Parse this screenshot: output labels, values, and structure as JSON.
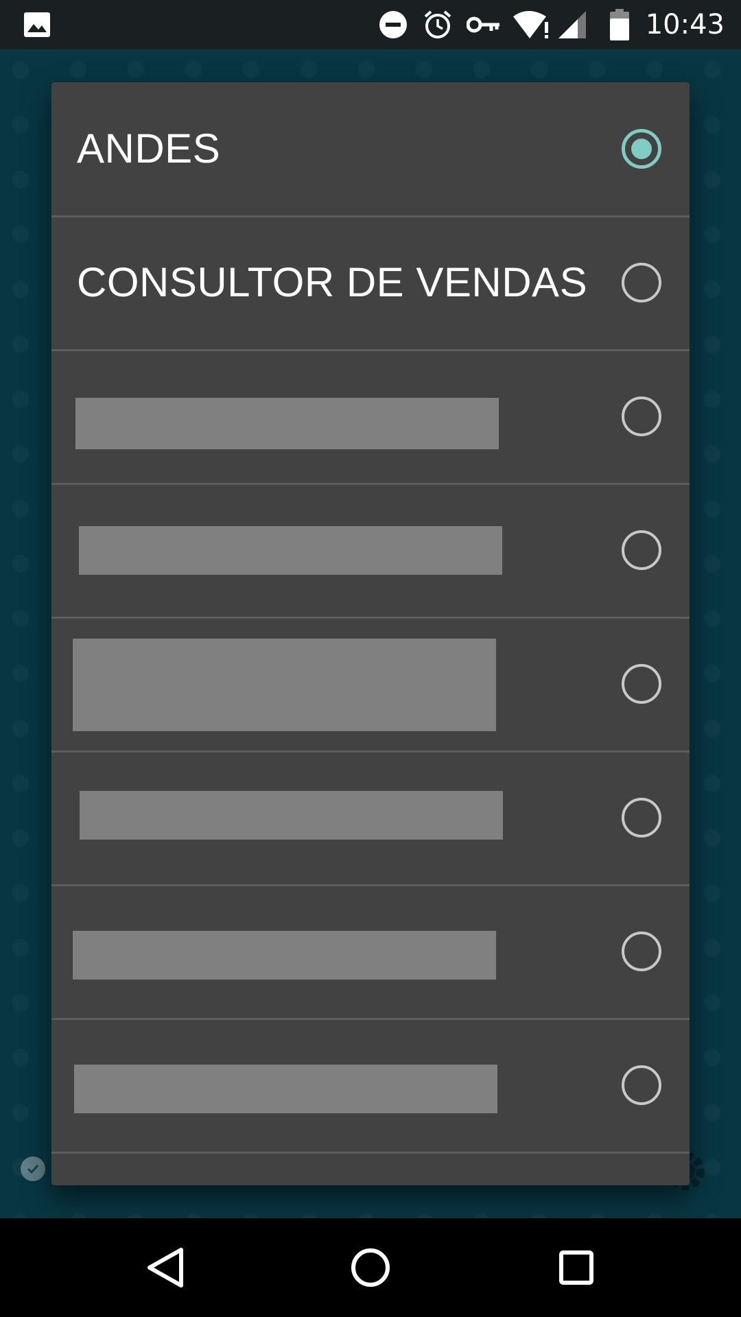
{
  "status_bar": {
    "time": "10:43",
    "icons": [
      "image-icon",
      "do-not-disturb-icon",
      "alarm-icon",
      "vpn-key-icon",
      "wifi-alert-icon",
      "cell-signal-icon",
      "battery-icon"
    ]
  },
  "dialog": {
    "options": [
      {
        "label": "ANDES",
        "selected": true,
        "redacted": false
      },
      {
        "label": "CONSULTOR DE VENDAS",
        "selected": false,
        "redacted": false
      },
      {
        "label": "",
        "selected": false,
        "redacted": true
      },
      {
        "label": "",
        "selected": false,
        "redacted": true
      },
      {
        "label": "",
        "selected": false,
        "redacted": true
      },
      {
        "label": "",
        "selected": false,
        "redacted": true
      },
      {
        "label": "",
        "selected": false,
        "redacted": true
      },
      {
        "label": "",
        "selected": false,
        "redacted": true
      }
    ]
  },
  "colors": {
    "dialog_background": "#424242",
    "accent": "#80cbc4",
    "app_background": "#0b4657",
    "redaction": "#808080"
  },
  "nav_bar": {
    "icons": [
      "back-icon",
      "home-icon",
      "recents-icon"
    ]
  }
}
